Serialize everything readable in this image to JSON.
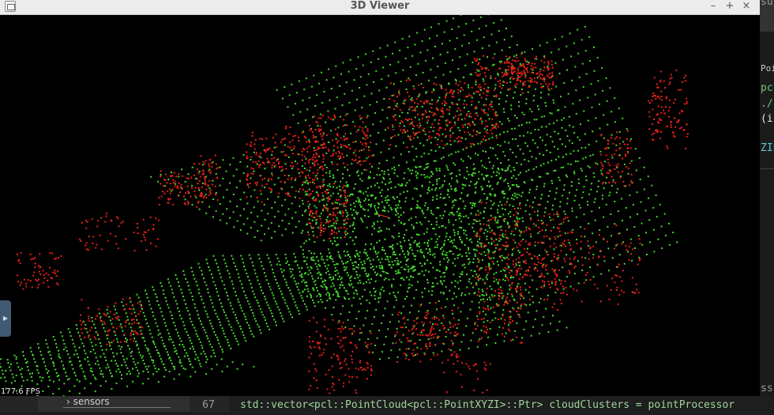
{
  "window": {
    "title": "3D Viewer",
    "controls": [
      "–",
      "+",
      "×"
    ]
  },
  "viewer": {
    "fps_text": "177.6 FPS",
    "colors": {
      "ground": "#44dd2c",
      "obstacles": "#e8201a",
      "axis_x": "#ff3030",
      "axis_y": "#30ff30",
      "background": "#000000"
    },
    "side_handle_icon": "play-triangle-icon"
  },
  "editor_right": {
    "lines": [
      {
        "text": "su",
        "color": "#9a9a9a"
      },
      {
        "text": "Poi",
        "color": "#c8c8c8"
      },
      {
        "text": "pcl",
        "color": "#6fc27a"
      },
      {
        "text": "./",
        "color": "#6fc27a"
      },
      {
        "text": "(i",
        "color": "#e6e6e6"
      },
      {
        "text": "ZIE",
        "color": "#5bc6d6"
      },
      {
        "text": "ss",
        "color": "#9a9a9a"
      }
    ]
  },
  "bottom": {
    "tree_item": "sensors",
    "tree_arrow": "›",
    "line_number": "67",
    "code": "std::vector<pcl::PointCloud<pcl::PointXYZI>::Ptr> cloudClusters = pointProcessor"
  }
}
